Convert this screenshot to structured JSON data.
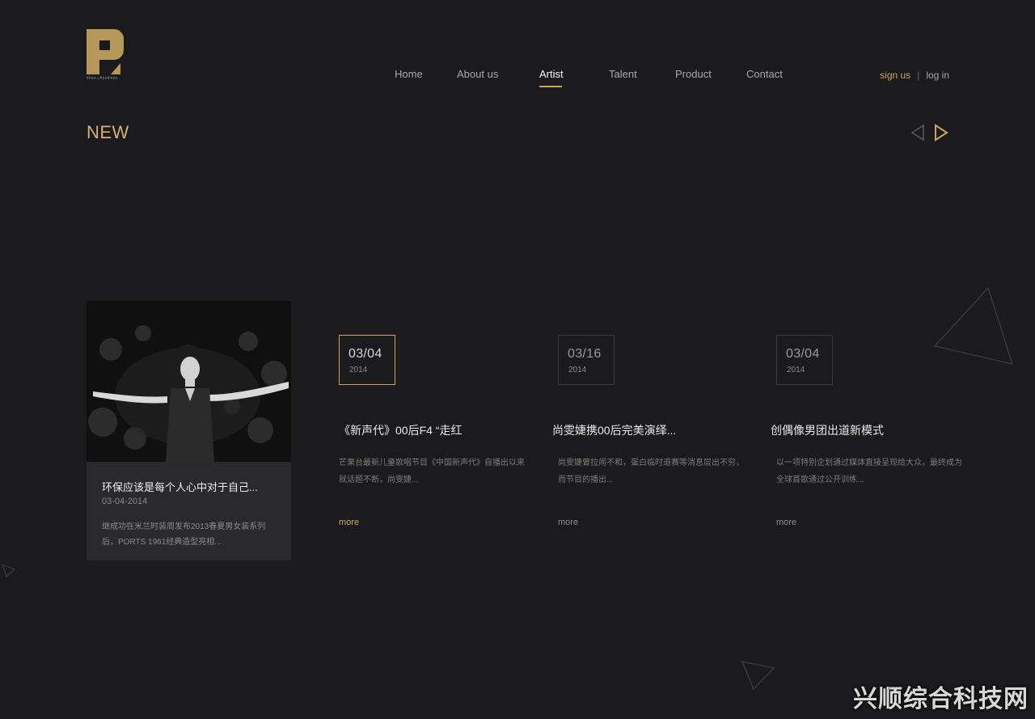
{
  "brand": {
    "logo_icon": "p-logo-icon",
    "tagline": "ithan | Anolimits",
    "accent": "#c7a665",
    "background": "#1b1a1c"
  },
  "nav": {
    "items": [
      {
        "label": "Home",
        "active": false
      },
      {
        "label": "About us",
        "active": false
      },
      {
        "label": "Artist",
        "active": true
      },
      {
        "label": "Talent",
        "active": false
      },
      {
        "label": "Product",
        "active": false
      },
      {
        "label": "Contact",
        "active": false
      }
    ]
  },
  "auth": {
    "sign_in": "sign us",
    "separator": "|",
    "log_in": "log in"
  },
  "section": {
    "title": "NEW",
    "prev_icon": "arrow-left-icon",
    "next_icon": "arrow-right-icon"
  },
  "featured": {
    "title": "环保应该是每个人心中对于自己...",
    "date": "03-04-2014",
    "excerpt": "继成功在米兰时装周发布2013春夏男女装系列后，PORTS 1961经典造型亮相..."
  },
  "news": [
    {
      "day": "03/04",
      "year": "2014",
      "title": "《新声代》00后F4 “走红",
      "excerpt": "芒果台最新儿童歌唱节目《中国新声代》自播出以来就话题不断，尚雯婕...",
      "more": "more"
    },
    {
      "day": "03/16",
      "year": "2014",
      "title": "尚雯婕携00后完美演绎...",
      "excerpt": "尚雯婕曾拉闹不和，蛋白临时退赛等消息层出不穷，而节目的播出...",
      "more": "more"
    },
    {
      "day": "03/04",
      "year": "2014",
      "title": "创偶像男团出道新模式",
      "excerpt": "以一项特别企划通过媒体直接呈现给大众，最终成为全球首歌通过公开训练...",
      "more": "more"
    }
  ],
  "watermark": "兴顺综合科技网"
}
